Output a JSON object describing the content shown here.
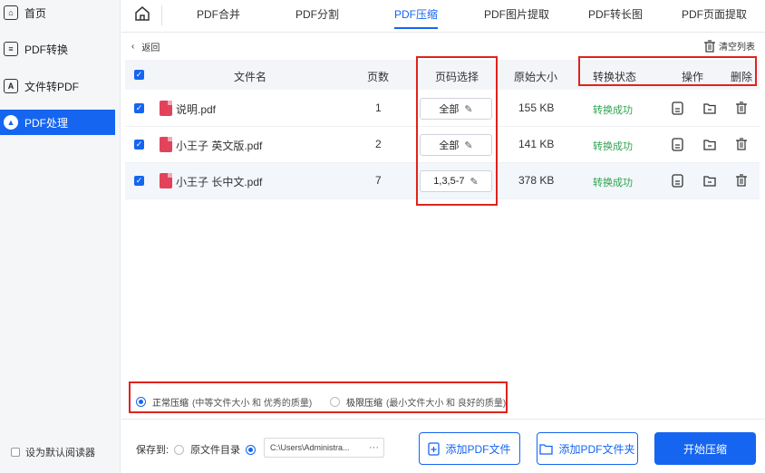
{
  "sidebar": {
    "items": [
      {
        "label": "首页",
        "icon": "home-icon"
      },
      {
        "label": "PDF转换",
        "icon": "convert-icon"
      },
      {
        "label": "文件转PDF",
        "icon": "file-to-pdf-icon"
      },
      {
        "label": "PDF处理",
        "icon": "pdf-process-icon"
      }
    ],
    "default_reader": "设为默认阅读器"
  },
  "tabs": [
    "PDF合并",
    "PDF分割",
    "PDF压缩",
    "PDF图片提取",
    "PDF转长图",
    "PDF页面提取"
  ],
  "active_tab": "PDF压缩",
  "toolbar": {
    "back": "返回",
    "clear": "清空列表"
  },
  "table": {
    "headers": {
      "name": "文件名",
      "pages": "页数",
      "page_select": "页码选择",
      "size": "原始大小",
      "status": "转换状态",
      "ops": "操作",
      "delete": "删除"
    },
    "rows": [
      {
        "name": "说明.pdf",
        "pages": "1",
        "page_select": "全部",
        "size": "155 KB",
        "status": "转换成功"
      },
      {
        "name": "小王子 英文版.pdf",
        "pages": "2",
        "page_select": "全部",
        "size": "141 KB",
        "status": "转换成功"
      },
      {
        "name": "小王子 长中文.pdf",
        "pages": "7",
        "page_select": "1,3,5-7",
        "size": "378 KB",
        "status": "转换成功"
      }
    ]
  },
  "compression": {
    "normal": {
      "label": "正常压缩",
      "desc": "(中等文件大小 和 优秀的质量)"
    },
    "extreme": {
      "label": "极限压缩",
      "desc": "(最小文件大小 和 良好的质量)"
    }
  },
  "save": {
    "label": "保存到:",
    "original_dir": "原文件目录",
    "path": "C:\\Users\\Administra...",
    "dots": "···"
  },
  "buttons": {
    "add_pdf": "添加PDF文件",
    "add_folder": "添加PDF文件夹",
    "start": "开始压缩"
  },
  "colors": {
    "accent": "#1565f0",
    "success": "#2ea44f",
    "annotation": "#e0231c"
  }
}
